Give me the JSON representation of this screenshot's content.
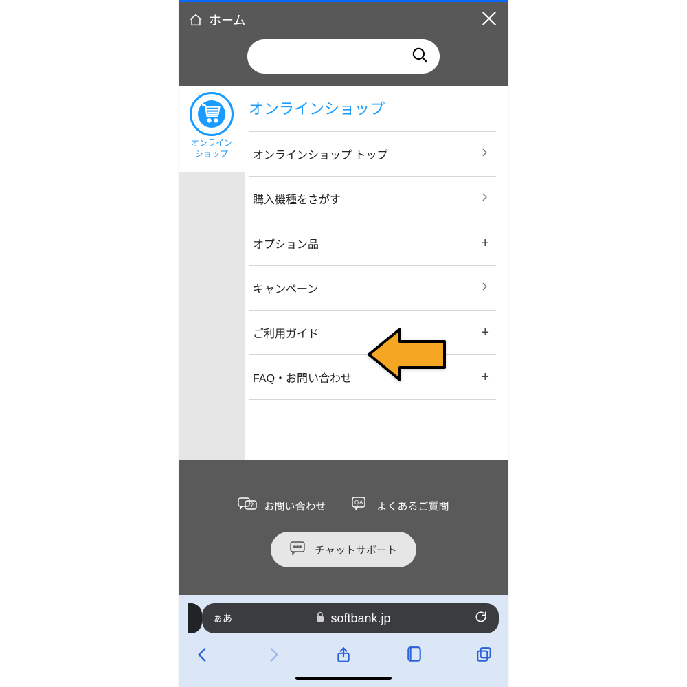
{
  "header": {
    "home_label": "ホーム"
  },
  "search": {
    "placeholder": ""
  },
  "sidebar": {
    "label_line1": "オンライン",
    "label_line2": "ショップ"
  },
  "section": {
    "title": "オンラインショップ"
  },
  "menu": {
    "items": [
      {
        "label": "オンラインショップ トップ",
        "kind": "chevron"
      },
      {
        "label": "購入機種をさがす",
        "kind": "chevron"
      },
      {
        "label": "オプション品",
        "kind": "plus"
      },
      {
        "label": "キャンペーン",
        "kind": "chevron"
      },
      {
        "label": "ご利用ガイド",
        "kind": "plus"
      },
      {
        "label": "FAQ・お問い合わせ",
        "kind": "plus"
      }
    ]
  },
  "footer": {
    "contact": "お問い合わせ",
    "faq": "よくあるご質問",
    "chat": "チャットサポート"
  },
  "browser": {
    "aa": "ぁあ",
    "domain": "softbank.jp"
  },
  "colors": {
    "accent": "#1a9bff",
    "arrow_fill": "#f5a623",
    "arrow_stroke": "#000000"
  }
}
